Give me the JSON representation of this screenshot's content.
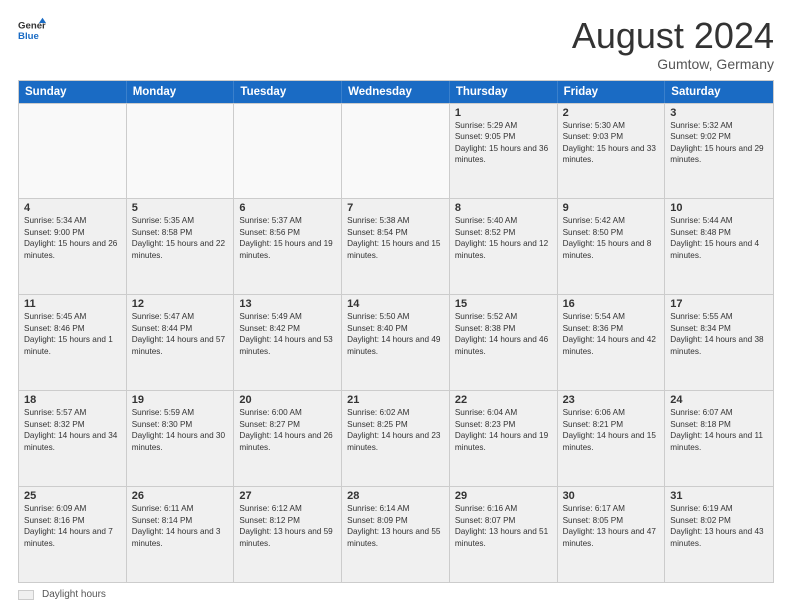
{
  "header": {
    "logo_line1": "General",
    "logo_line2": "Blue",
    "title": "August 2024",
    "subtitle": "Gumtow, Germany"
  },
  "footer": {
    "swatch_label": "Daylight hours"
  },
  "days_of_week": [
    "Sunday",
    "Monday",
    "Tuesday",
    "Wednesday",
    "Thursday",
    "Friday",
    "Saturday"
  ],
  "weeks": [
    [
      {
        "day": "",
        "info": "",
        "empty": true
      },
      {
        "day": "",
        "info": "",
        "empty": true
      },
      {
        "day": "",
        "info": "",
        "empty": true
      },
      {
        "day": "",
        "info": "",
        "empty": true
      },
      {
        "day": "1",
        "info": "Sunrise: 5:29 AM\nSunset: 9:05 PM\nDaylight: 15 hours and 36 minutes.",
        "shaded": true
      },
      {
        "day": "2",
        "info": "Sunrise: 5:30 AM\nSunset: 9:03 PM\nDaylight: 15 hours and 33 minutes.",
        "shaded": true
      },
      {
        "day": "3",
        "info": "Sunrise: 5:32 AM\nSunset: 9:02 PM\nDaylight: 15 hours and 29 minutes.",
        "shaded": true
      }
    ],
    [
      {
        "day": "4",
        "info": "Sunrise: 5:34 AM\nSunset: 9:00 PM\nDaylight: 15 hours and 26 minutes.",
        "shaded": true
      },
      {
        "day": "5",
        "info": "Sunrise: 5:35 AM\nSunset: 8:58 PM\nDaylight: 15 hours and 22 minutes.",
        "shaded": true
      },
      {
        "day": "6",
        "info": "Sunrise: 5:37 AM\nSunset: 8:56 PM\nDaylight: 15 hours and 19 minutes.",
        "shaded": true
      },
      {
        "day": "7",
        "info": "Sunrise: 5:38 AM\nSunset: 8:54 PM\nDaylight: 15 hours and 15 minutes.",
        "shaded": true
      },
      {
        "day": "8",
        "info": "Sunrise: 5:40 AM\nSunset: 8:52 PM\nDaylight: 15 hours and 12 minutes.",
        "shaded": true
      },
      {
        "day": "9",
        "info": "Sunrise: 5:42 AM\nSunset: 8:50 PM\nDaylight: 15 hours and 8 minutes.",
        "shaded": true
      },
      {
        "day": "10",
        "info": "Sunrise: 5:44 AM\nSunset: 8:48 PM\nDaylight: 15 hours and 4 minutes.",
        "shaded": true
      }
    ],
    [
      {
        "day": "11",
        "info": "Sunrise: 5:45 AM\nSunset: 8:46 PM\nDaylight: 15 hours and 1 minute.",
        "shaded": true
      },
      {
        "day": "12",
        "info": "Sunrise: 5:47 AM\nSunset: 8:44 PM\nDaylight: 14 hours and 57 minutes.",
        "shaded": true
      },
      {
        "day": "13",
        "info": "Sunrise: 5:49 AM\nSunset: 8:42 PM\nDaylight: 14 hours and 53 minutes.",
        "shaded": true
      },
      {
        "day": "14",
        "info": "Sunrise: 5:50 AM\nSunset: 8:40 PM\nDaylight: 14 hours and 49 minutes.",
        "shaded": true
      },
      {
        "day": "15",
        "info": "Sunrise: 5:52 AM\nSunset: 8:38 PM\nDaylight: 14 hours and 46 minutes.",
        "shaded": true
      },
      {
        "day": "16",
        "info": "Sunrise: 5:54 AM\nSunset: 8:36 PM\nDaylight: 14 hours and 42 minutes.",
        "shaded": true
      },
      {
        "day": "17",
        "info": "Sunrise: 5:55 AM\nSunset: 8:34 PM\nDaylight: 14 hours and 38 minutes.",
        "shaded": true
      }
    ],
    [
      {
        "day": "18",
        "info": "Sunrise: 5:57 AM\nSunset: 8:32 PM\nDaylight: 14 hours and 34 minutes.",
        "shaded": true
      },
      {
        "day": "19",
        "info": "Sunrise: 5:59 AM\nSunset: 8:30 PM\nDaylight: 14 hours and 30 minutes.",
        "shaded": true
      },
      {
        "day": "20",
        "info": "Sunrise: 6:00 AM\nSunset: 8:27 PM\nDaylight: 14 hours and 26 minutes.",
        "shaded": true
      },
      {
        "day": "21",
        "info": "Sunrise: 6:02 AM\nSunset: 8:25 PM\nDaylight: 14 hours and 23 minutes.",
        "shaded": true
      },
      {
        "day": "22",
        "info": "Sunrise: 6:04 AM\nSunset: 8:23 PM\nDaylight: 14 hours and 19 minutes.",
        "shaded": true
      },
      {
        "day": "23",
        "info": "Sunrise: 6:06 AM\nSunset: 8:21 PM\nDaylight: 14 hours and 15 minutes.",
        "shaded": true
      },
      {
        "day": "24",
        "info": "Sunrise: 6:07 AM\nSunset: 8:18 PM\nDaylight: 14 hours and 11 minutes.",
        "shaded": true
      }
    ],
    [
      {
        "day": "25",
        "info": "Sunrise: 6:09 AM\nSunset: 8:16 PM\nDaylight: 14 hours and 7 minutes.",
        "shaded": true
      },
      {
        "day": "26",
        "info": "Sunrise: 6:11 AM\nSunset: 8:14 PM\nDaylight: 14 hours and 3 minutes.",
        "shaded": true
      },
      {
        "day": "27",
        "info": "Sunrise: 6:12 AM\nSunset: 8:12 PM\nDaylight: 13 hours and 59 minutes.",
        "shaded": true
      },
      {
        "day": "28",
        "info": "Sunrise: 6:14 AM\nSunset: 8:09 PM\nDaylight: 13 hours and 55 minutes.",
        "shaded": true
      },
      {
        "day": "29",
        "info": "Sunrise: 6:16 AM\nSunset: 8:07 PM\nDaylight: 13 hours and 51 minutes.",
        "shaded": true
      },
      {
        "day": "30",
        "info": "Sunrise: 6:17 AM\nSunset: 8:05 PM\nDaylight: 13 hours and 47 minutes.",
        "shaded": true
      },
      {
        "day": "31",
        "info": "Sunrise: 6:19 AM\nSunset: 8:02 PM\nDaylight: 13 hours and 43 minutes.",
        "shaded": true
      }
    ]
  ]
}
